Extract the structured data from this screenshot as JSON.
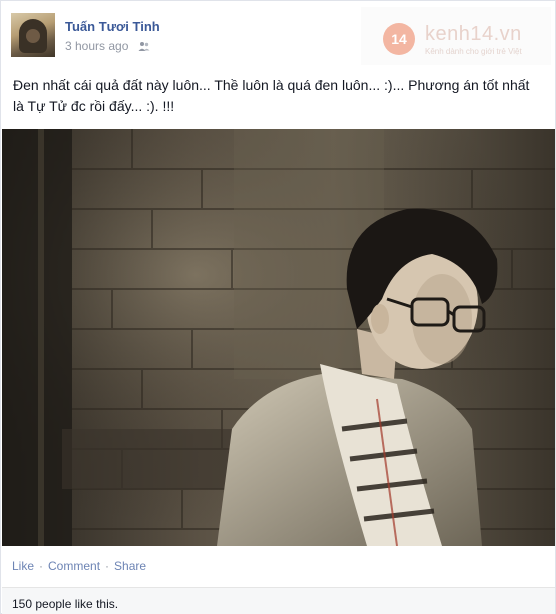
{
  "post": {
    "author": "Tuấn Tươi Tinh",
    "timestamp": "3 hours ago",
    "privacy_icon": "friends-icon",
    "status_text": "Đen nhất cái quả đất này luôn... Thề luôn là quá đen luôn... :)... Phương án tốt nhất là Tự Tử đc rồi đấy... :). !!!",
    "photo_alt": "Black and white photo of a young man with glasses and a striped scarf in front of a brick wall"
  },
  "watermark": {
    "logo_text": "14",
    "site": "kenh14.vn",
    "slogan": "Kênh dành cho giới trẻ Việt"
  },
  "actions": {
    "like": "Like",
    "comment": "Comment",
    "share": "Share",
    "separator": "·"
  },
  "likes": {
    "text": "150 people like this."
  },
  "colors": {
    "link": "#3b5998",
    "action_link": "#6d84b4",
    "muted": "#9197a3",
    "footer_bg": "#f6f7f8"
  }
}
